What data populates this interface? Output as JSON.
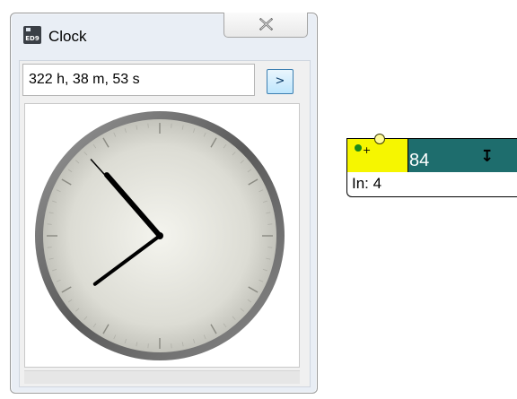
{
  "window": {
    "title": "Clock",
    "icon": "ED9",
    "close_icon": "close-x-icon"
  },
  "time_display": {
    "value": "322 h, 38 m, 53 s"
  },
  "go_button": {
    "label": ">"
  },
  "clock": {
    "hours": 10,
    "minutes": 38,
    "seconds": 53,
    "face_color": "#d6d6d0",
    "rim_color": "#6e6e6e"
  },
  "indicator": {
    "value": "84",
    "input_label": "In: 4",
    "arrow_icon": "down-arrow-icon",
    "header_color": "#1e6d6d",
    "tab_color": "#f6f600"
  }
}
